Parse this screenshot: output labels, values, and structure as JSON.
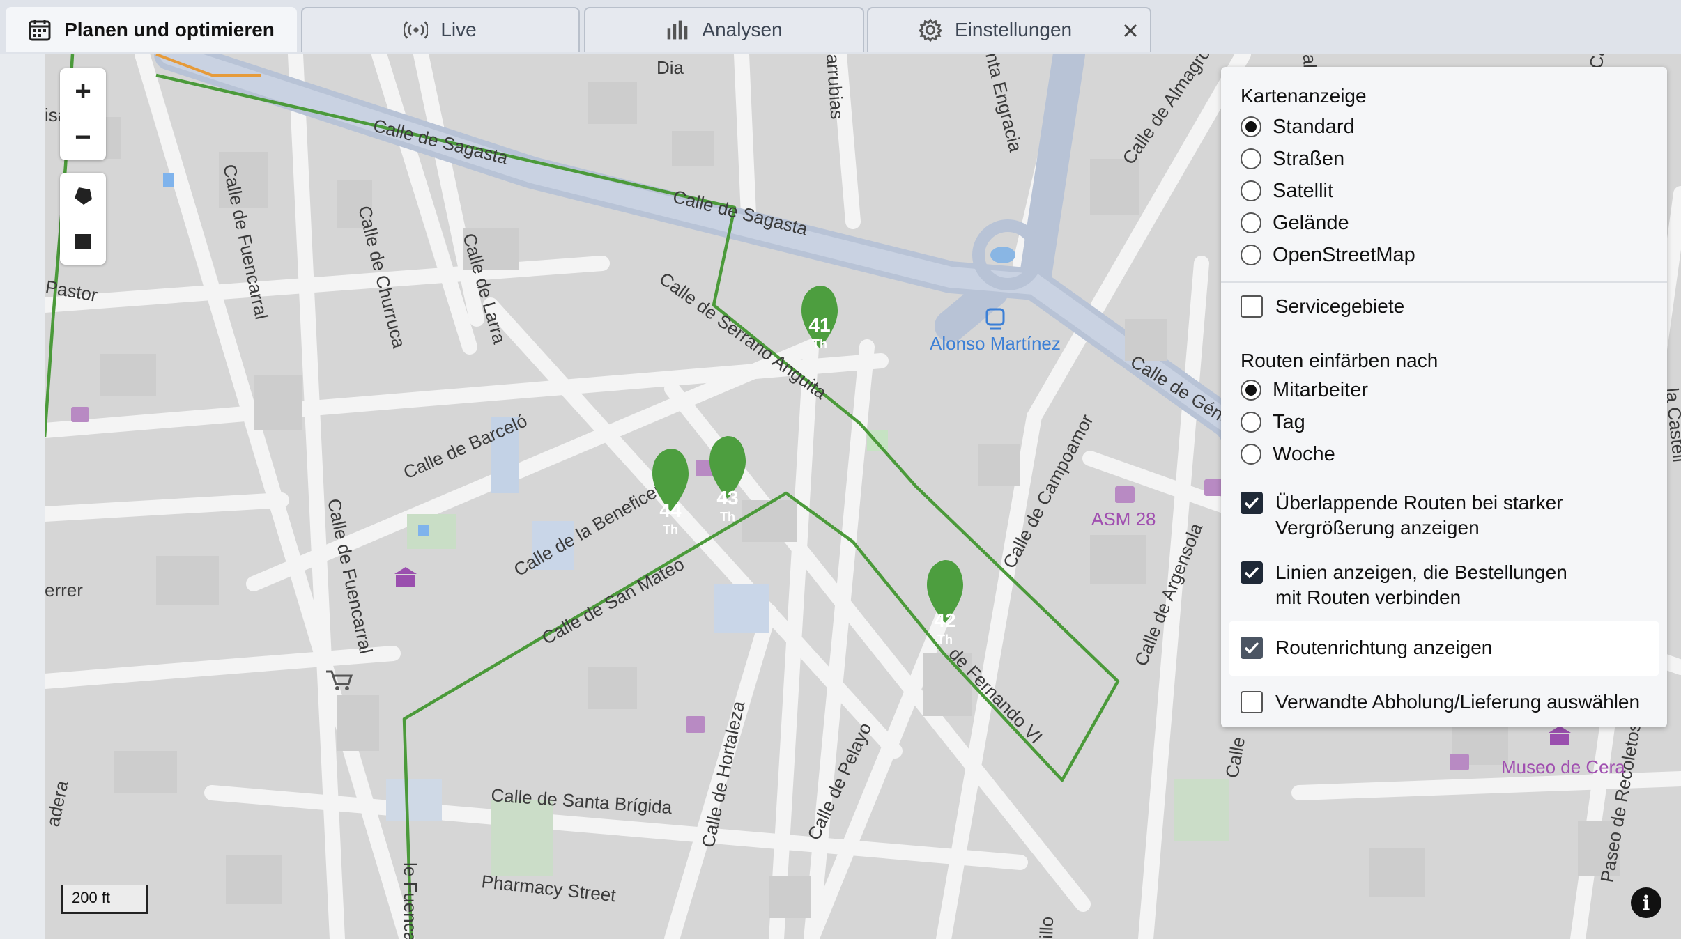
{
  "tabs": [
    {
      "label": "Planen und optimieren",
      "icon": "calendar-icon",
      "active": true
    },
    {
      "label": "Live",
      "icon": "broadcast-icon",
      "active": false
    },
    {
      "label": "Analysen",
      "icon": "bar-chart-icon",
      "active": false
    },
    {
      "label": "Einstellungen",
      "icon": "gear-icon",
      "active": false
    }
  ],
  "map": {
    "streets": {
      "sagasta1": "Calle de Sagasta",
      "sagasta2": "Calle de Sagasta",
      "fuencarral1": "Calle de Fuencarral",
      "fuencarral2": "Calle de Fuencarral",
      "fuencarral3": "le Fuencarral",
      "churruca": "Calle de Churruca",
      "larra": "Calle de Larra",
      "barcelo": "Calle de Barceló",
      "beneficencia": "Calle de la Beneficencia",
      "sanmateo": "Calle de San Mateo",
      "santabrigida": "Calle de Santa Brígida",
      "pharmacy": "Pharmacy Street",
      "hortaleza": "Calle de Hortaleza",
      "pelayo": "Calle de Pelayo",
      "campoamor": "Calle de Campoamor",
      "argensola": "Calle de Argensola",
      "genova": "Calle de Génova",
      "almagro": "Calle de Almagro",
      "fernando": "de Fernando VI",
      "serrano": "Calle de Serrano Anguita",
      "recoletos": "Paseo de Recoletos",
      "dia": "Dia",
      "arrubias": "arrubias",
      "engracia": "nta Engracia",
      "pastor": "Pastor",
      "errer": "errer",
      "adera": "adera",
      "isa": "isa",
      "illo": "illo",
      "calle_r": "Calle",
      "castell": "la Castell",
      "ca_top": "Ca",
      "all_top": "all"
    },
    "pois": {
      "metro": "Alonso Martínez",
      "asm": "ASM 28",
      "museo": "Museo de Cera"
    },
    "pins": [
      {
        "number": "41",
        "sub": "Th"
      },
      {
        "number": "42",
        "sub": "Th"
      },
      {
        "number": "43",
        "sub": "Th"
      },
      {
        "number": "44",
        "sub": "Th"
      }
    ],
    "scale": "200 ft",
    "route_color": "#4b9a3a"
  },
  "controls": {
    "zoom_in": "+",
    "zoom_out": "−"
  },
  "panel": {
    "map_display_title": "Kartenanzeige",
    "map_display_options": [
      {
        "label": "Standard",
        "checked": true
      },
      {
        "label": "Straßen",
        "checked": false
      },
      {
        "label": "Satellit",
        "checked": false
      },
      {
        "label": "Gelände",
        "checked": false
      },
      {
        "label": "OpenStreetMap",
        "checked": false
      }
    ],
    "service_areas": {
      "label": "Servicegebiete",
      "checked": false
    },
    "color_routes_title": "Routen einfärben nach",
    "color_routes_options": [
      {
        "label": "Mitarbeiter",
        "checked": true
      },
      {
        "label": "Tag",
        "checked": false
      },
      {
        "label": "Woche",
        "checked": false
      }
    ],
    "checkboxes": [
      {
        "line1": "Überlappende Routen bei starker",
        "line2": "Vergrößerung anzeigen",
        "checked": true
      },
      {
        "line1": "Linien anzeigen, die Bestellungen",
        "line2": "mit Routen verbinden",
        "checked": true
      },
      {
        "line1": "Routenrichtung anzeigen",
        "line2": "",
        "checked": true
      },
      {
        "line1": "Verwandte Abholung/Lieferung auswählen",
        "line2": "",
        "checked": false
      }
    ]
  }
}
